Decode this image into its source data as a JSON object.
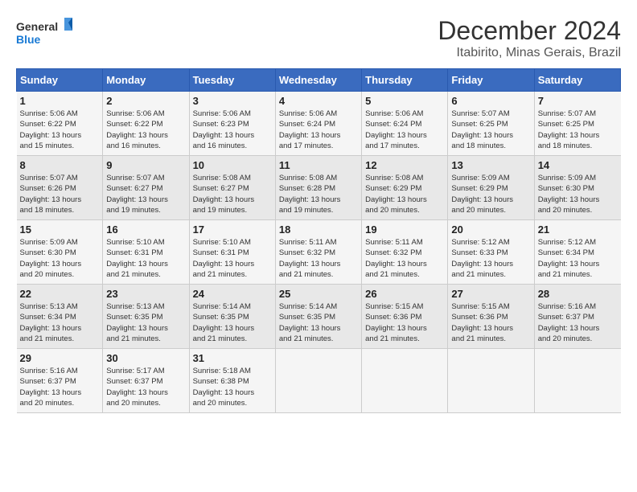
{
  "logo": {
    "line1": "General",
    "line2": "Blue"
  },
  "title": "December 2024",
  "location": "Itabirito, Minas Gerais, Brazil",
  "weekdays": [
    "Sunday",
    "Monday",
    "Tuesday",
    "Wednesday",
    "Thursday",
    "Friday",
    "Saturday"
  ],
  "weeks": [
    [
      {
        "day": "1",
        "info": "Sunrise: 5:06 AM\nSunset: 6:22 PM\nDaylight: 13 hours\nand 15 minutes."
      },
      {
        "day": "2",
        "info": "Sunrise: 5:06 AM\nSunset: 6:22 PM\nDaylight: 13 hours\nand 16 minutes."
      },
      {
        "day": "3",
        "info": "Sunrise: 5:06 AM\nSunset: 6:23 PM\nDaylight: 13 hours\nand 16 minutes."
      },
      {
        "day": "4",
        "info": "Sunrise: 5:06 AM\nSunset: 6:24 PM\nDaylight: 13 hours\nand 17 minutes."
      },
      {
        "day": "5",
        "info": "Sunrise: 5:06 AM\nSunset: 6:24 PM\nDaylight: 13 hours\nand 17 minutes."
      },
      {
        "day": "6",
        "info": "Sunrise: 5:07 AM\nSunset: 6:25 PM\nDaylight: 13 hours\nand 18 minutes."
      },
      {
        "day": "7",
        "info": "Sunrise: 5:07 AM\nSunset: 6:25 PM\nDaylight: 13 hours\nand 18 minutes."
      }
    ],
    [
      {
        "day": "8",
        "info": "Sunrise: 5:07 AM\nSunset: 6:26 PM\nDaylight: 13 hours\nand 18 minutes."
      },
      {
        "day": "9",
        "info": "Sunrise: 5:07 AM\nSunset: 6:27 PM\nDaylight: 13 hours\nand 19 minutes."
      },
      {
        "day": "10",
        "info": "Sunrise: 5:08 AM\nSunset: 6:27 PM\nDaylight: 13 hours\nand 19 minutes."
      },
      {
        "day": "11",
        "info": "Sunrise: 5:08 AM\nSunset: 6:28 PM\nDaylight: 13 hours\nand 19 minutes."
      },
      {
        "day": "12",
        "info": "Sunrise: 5:08 AM\nSunset: 6:29 PM\nDaylight: 13 hours\nand 20 minutes."
      },
      {
        "day": "13",
        "info": "Sunrise: 5:09 AM\nSunset: 6:29 PM\nDaylight: 13 hours\nand 20 minutes."
      },
      {
        "day": "14",
        "info": "Sunrise: 5:09 AM\nSunset: 6:30 PM\nDaylight: 13 hours\nand 20 minutes."
      }
    ],
    [
      {
        "day": "15",
        "info": "Sunrise: 5:09 AM\nSunset: 6:30 PM\nDaylight: 13 hours\nand 20 minutes."
      },
      {
        "day": "16",
        "info": "Sunrise: 5:10 AM\nSunset: 6:31 PM\nDaylight: 13 hours\nand 21 minutes."
      },
      {
        "day": "17",
        "info": "Sunrise: 5:10 AM\nSunset: 6:31 PM\nDaylight: 13 hours\nand 21 minutes."
      },
      {
        "day": "18",
        "info": "Sunrise: 5:11 AM\nSunset: 6:32 PM\nDaylight: 13 hours\nand 21 minutes."
      },
      {
        "day": "19",
        "info": "Sunrise: 5:11 AM\nSunset: 6:32 PM\nDaylight: 13 hours\nand 21 minutes."
      },
      {
        "day": "20",
        "info": "Sunrise: 5:12 AM\nSunset: 6:33 PM\nDaylight: 13 hours\nand 21 minutes."
      },
      {
        "day": "21",
        "info": "Sunrise: 5:12 AM\nSunset: 6:34 PM\nDaylight: 13 hours\nand 21 minutes."
      }
    ],
    [
      {
        "day": "22",
        "info": "Sunrise: 5:13 AM\nSunset: 6:34 PM\nDaylight: 13 hours\nand 21 minutes."
      },
      {
        "day": "23",
        "info": "Sunrise: 5:13 AM\nSunset: 6:35 PM\nDaylight: 13 hours\nand 21 minutes."
      },
      {
        "day": "24",
        "info": "Sunrise: 5:14 AM\nSunset: 6:35 PM\nDaylight: 13 hours\nand 21 minutes."
      },
      {
        "day": "25",
        "info": "Sunrise: 5:14 AM\nSunset: 6:35 PM\nDaylight: 13 hours\nand 21 minutes."
      },
      {
        "day": "26",
        "info": "Sunrise: 5:15 AM\nSunset: 6:36 PM\nDaylight: 13 hours\nand 21 minutes."
      },
      {
        "day": "27",
        "info": "Sunrise: 5:15 AM\nSunset: 6:36 PM\nDaylight: 13 hours\nand 21 minutes."
      },
      {
        "day": "28",
        "info": "Sunrise: 5:16 AM\nSunset: 6:37 PM\nDaylight: 13 hours\nand 20 minutes."
      }
    ],
    [
      {
        "day": "29",
        "info": "Sunrise: 5:16 AM\nSunset: 6:37 PM\nDaylight: 13 hours\nand 20 minutes."
      },
      {
        "day": "30",
        "info": "Sunrise: 5:17 AM\nSunset: 6:37 PM\nDaylight: 13 hours\nand 20 minutes."
      },
      {
        "day": "31",
        "info": "Sunrise: 5:18 AM\nSunset: 6:38 PM\nDaylight: 13 hours\nand 20 minutes."
      },
      {
        "day": "",
        "info": ""
      },
      {
        "day": "",
        "info": ""
      },
      {
        "day": "",
        "info": ""
      },
      {
        "day": "",
        "info": ""
      }
    ]
  ]
}
